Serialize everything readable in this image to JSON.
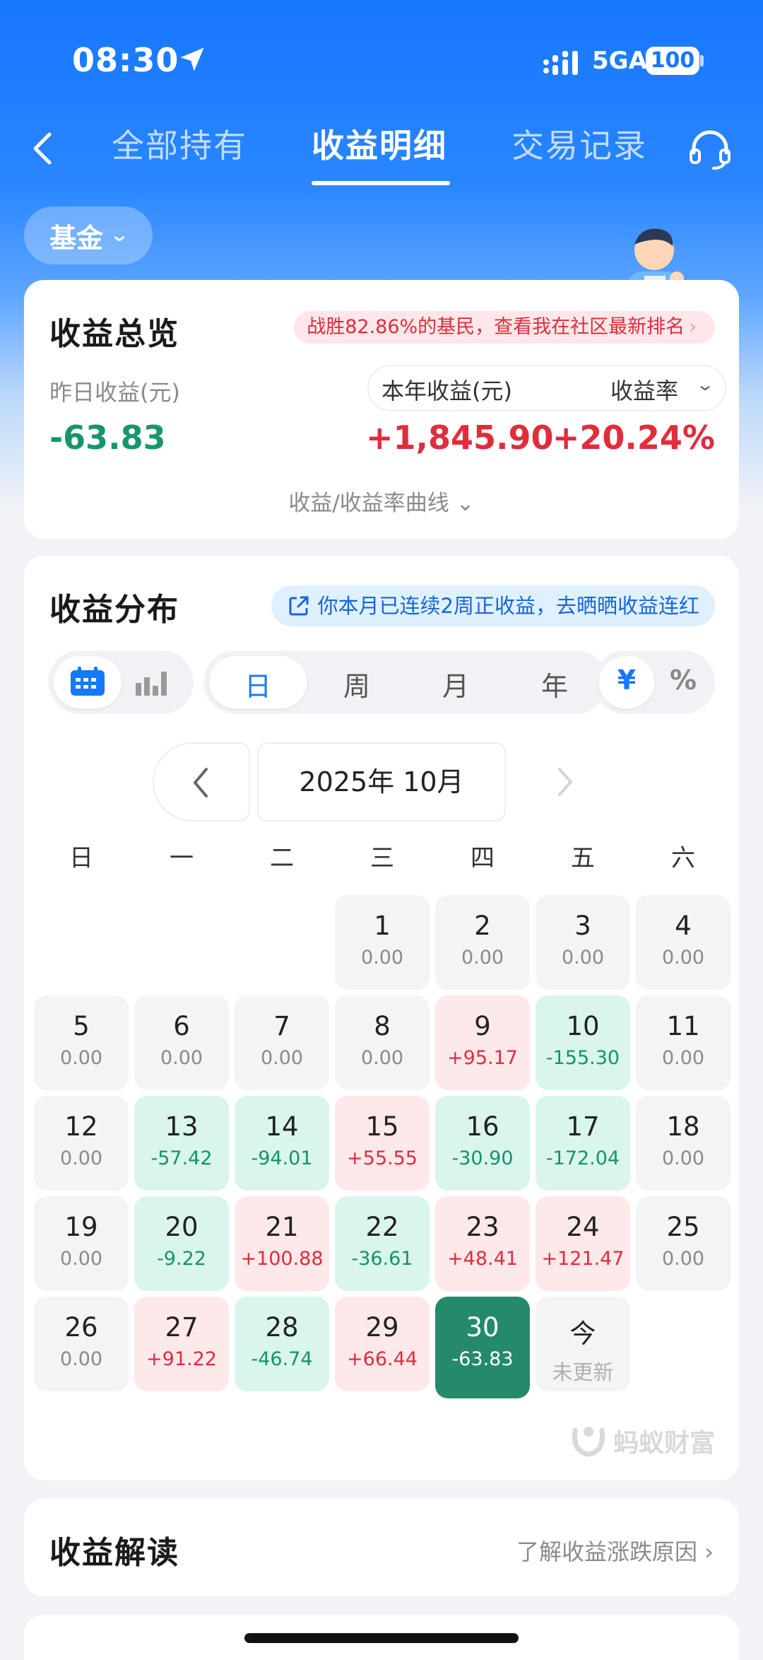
{
  "status_bar": {
    "time": "08:30",
    "network": "5GA",
    "battery": "100"
  },
  "nav": {
    "tabs": [
      {
        "label": "全部持有"
      },
      {
        "label": "收益明细"
      },
      {
        "label": "交易记录"
      }
    ]
  },
  "filter": {
    "label": "基金"
  },
  "overview": {
    "title": "收益总览",
    "rank_text": "战胜82.86%的基民，查看我在社区最新排名",
    "yesterday_label": "昨日收益(元)",
    "yesterday_value": "-63.83",
    "year_label": "本年收益(元)",
    "rate_label": "收益率",
    "year_value": "+1,845.90",
    "rate_value": "+20.24%",
    "curve_link": "收益/收益率曲线"
  },
  "distribution": {
    "title": "收益分布",
    "streak_text": "你本月已连续2周正收益，去晒晒收益连红",
    "periods": [
      "日",
      "周",
      "月",
      "年"
    ],
    "units": [
      "¥",
      "%"
    ],
    "month": "2025年 10月",
    "weekdays": [
      "日",
      "一",
      "二",
      "三",
      "四",
      "五",
      "六"
    ],
    "days": [
      {
        "d": "1",
        "v": "0.00",
        "s": "zero"
      },
      {
        "d": "2",
        "v": "0.00",
        "s": "zero"
      },
      {
        "d": "3",
        "v": "0.00",
        "s": "zero"
      },
      {
        "d": "4",
        "v": "0.00",
        "s": "zero"
      },
      {
        "d": "5",
        "v": "0.00",
        "s": "zero"
      },
      {
        "d": "6",
        "v": "0.00",
        "s": "zero"
      },
      {
        "d": "7",
        "v": "0.00",
        "s": "zero"
      },
      {
        "d": "8",
        "v": "0.00",
        "s": "zero"
      },
      {
        "d": "9",
        "v": "+95.17",
        "s": "pos"
      },
      {
        "d": "10",
        "v": "-155.30",
        "s": "neg"
      },
      {
        "d": "11",
        "v": "0.00",
        "s": "zero"
      },
      {
        "d": "12",
        "v": "0.00",
        "s": "zero"
      },
      {
        "d": "13",
        "v": "-57.42",
        "s": "neg"
      },
      {
        "d": "14",
        "v": "-94.01",
        "s": "neg"
      },
      {
        "d": "15",
        "v": "+55.55",
        "s": "pos"
      },
      {
        "d": "16",
        "v": "-30.90",
        "s": "neg"
      },
      {
        "d": "17",
        "v": "-172.04",
        "s": "neg"
      },
      {
        "d": "18",
        "v": "0.00",
        "s": "zero"
      },
      {
        "d": "19",
        "v": "0.00",
        "s": "zero"
      },
      {
        "d": "20",
        "v": "-9.22",
        "s": "neg"
      },
      {
        "d": "21",
        "v": "+100.88",
        "s": "pos"
      },
      {
        "d": "22",
        "v": "-36.61",
        "s": "neg"
      },
      {
        "d": "23",
        "v": "+48.41",
        "s": "pos"
      },
      {
        "d": "24",
        "v": "+121.47",
        "s": "pos"
      },
      {
        "d": "25",
        "v": "0.00",
        "s": "zero"
      },
      {
        "d": "26",
        "v": "0.00",
        "s": "zero"
      },
      {
        "d": "27",
        "v": "+91.22",
        "s": "pos"
      },
      {
        "d": "28",
        "v": "-46.74",
        "s": "neg"
      },
      {
        "d": "29",
        "v": "+66.44",
        "s": "pos"
      },
      {
        "d": "30",
        "v": "-63.83",
        "s": "today"
      },
      {
        "d": "今",
        "v": "未更新",
        "s": "future"
      }
    ],
    "first_weekday": 3,
    "brand": "蚂蚁财富"
  },
  "analysis": {
    "title": "收益解读",
    "link": "了解收益涨跌原因"
  },
  "colors": {
    "primary": "#1677ff",
    "gain": "#e02d3c",
    "loss": "#13946b",
    "today": "#258a6c"
  }
}
